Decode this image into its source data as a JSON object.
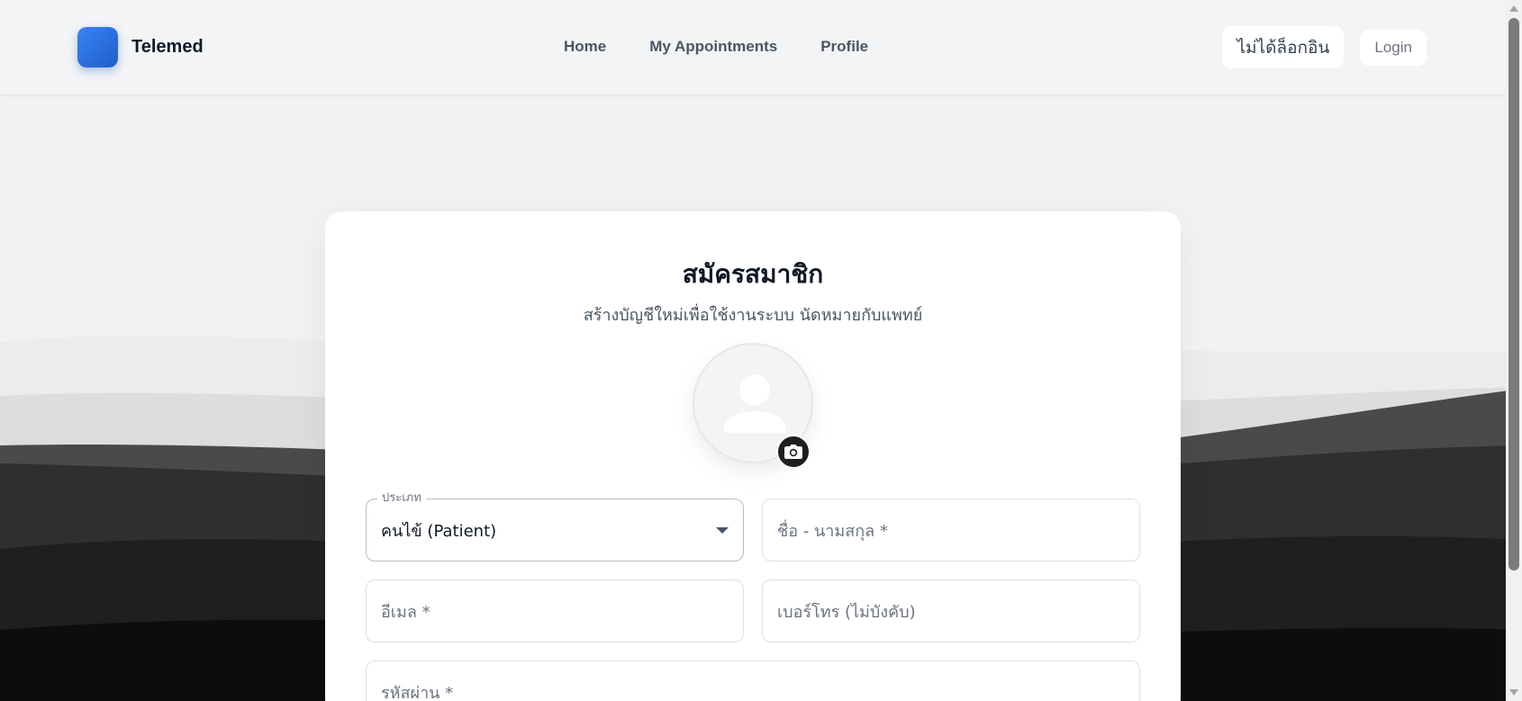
{
  "navbar": {
    "brand_name": "Telemed",
    "links": [
      {
        "label": "Home"
      },
      {
        "label": "My Appointments"
      },
      {
        "label": "Profile"
      }
    ],
    "status_label": "ไม่ได้ล็อกอิน",
    "login_label": "Login"
  },
  "form": {
    "title": "สมัครสมาชิก",
    "subtitle": "สร้างบัญชีใหม่เพื่อใช้งานระบบ นัดหมายกับแพทย์",
    "type_select": {
      "label": "ประเภท",
      "value": "คนไข้ (Patient)"
    },
    "fullname_placeholder": "ชื่อ - นามสกุล *",
    "email_placeholder": "อีเมล *",
    "phone_placeholder": "เบอร์โทร (ไม่บังคับ)",
    "password_placeholder": "รหัสผ่าน *"
  },
  "icons": {
    "logo": "logo-icon",
    "avatar": "user-placeholder-icon",
    "camera": "camera-icon",
    "dropdown": "chevron-down-icon"
  },
  "colors": {
    "brand": "#2563eb",
    "nav_text": "#4b5563",
    "card_bg": "#ffffff",
    "page_bg": "#f1f1f2"
  }
}
